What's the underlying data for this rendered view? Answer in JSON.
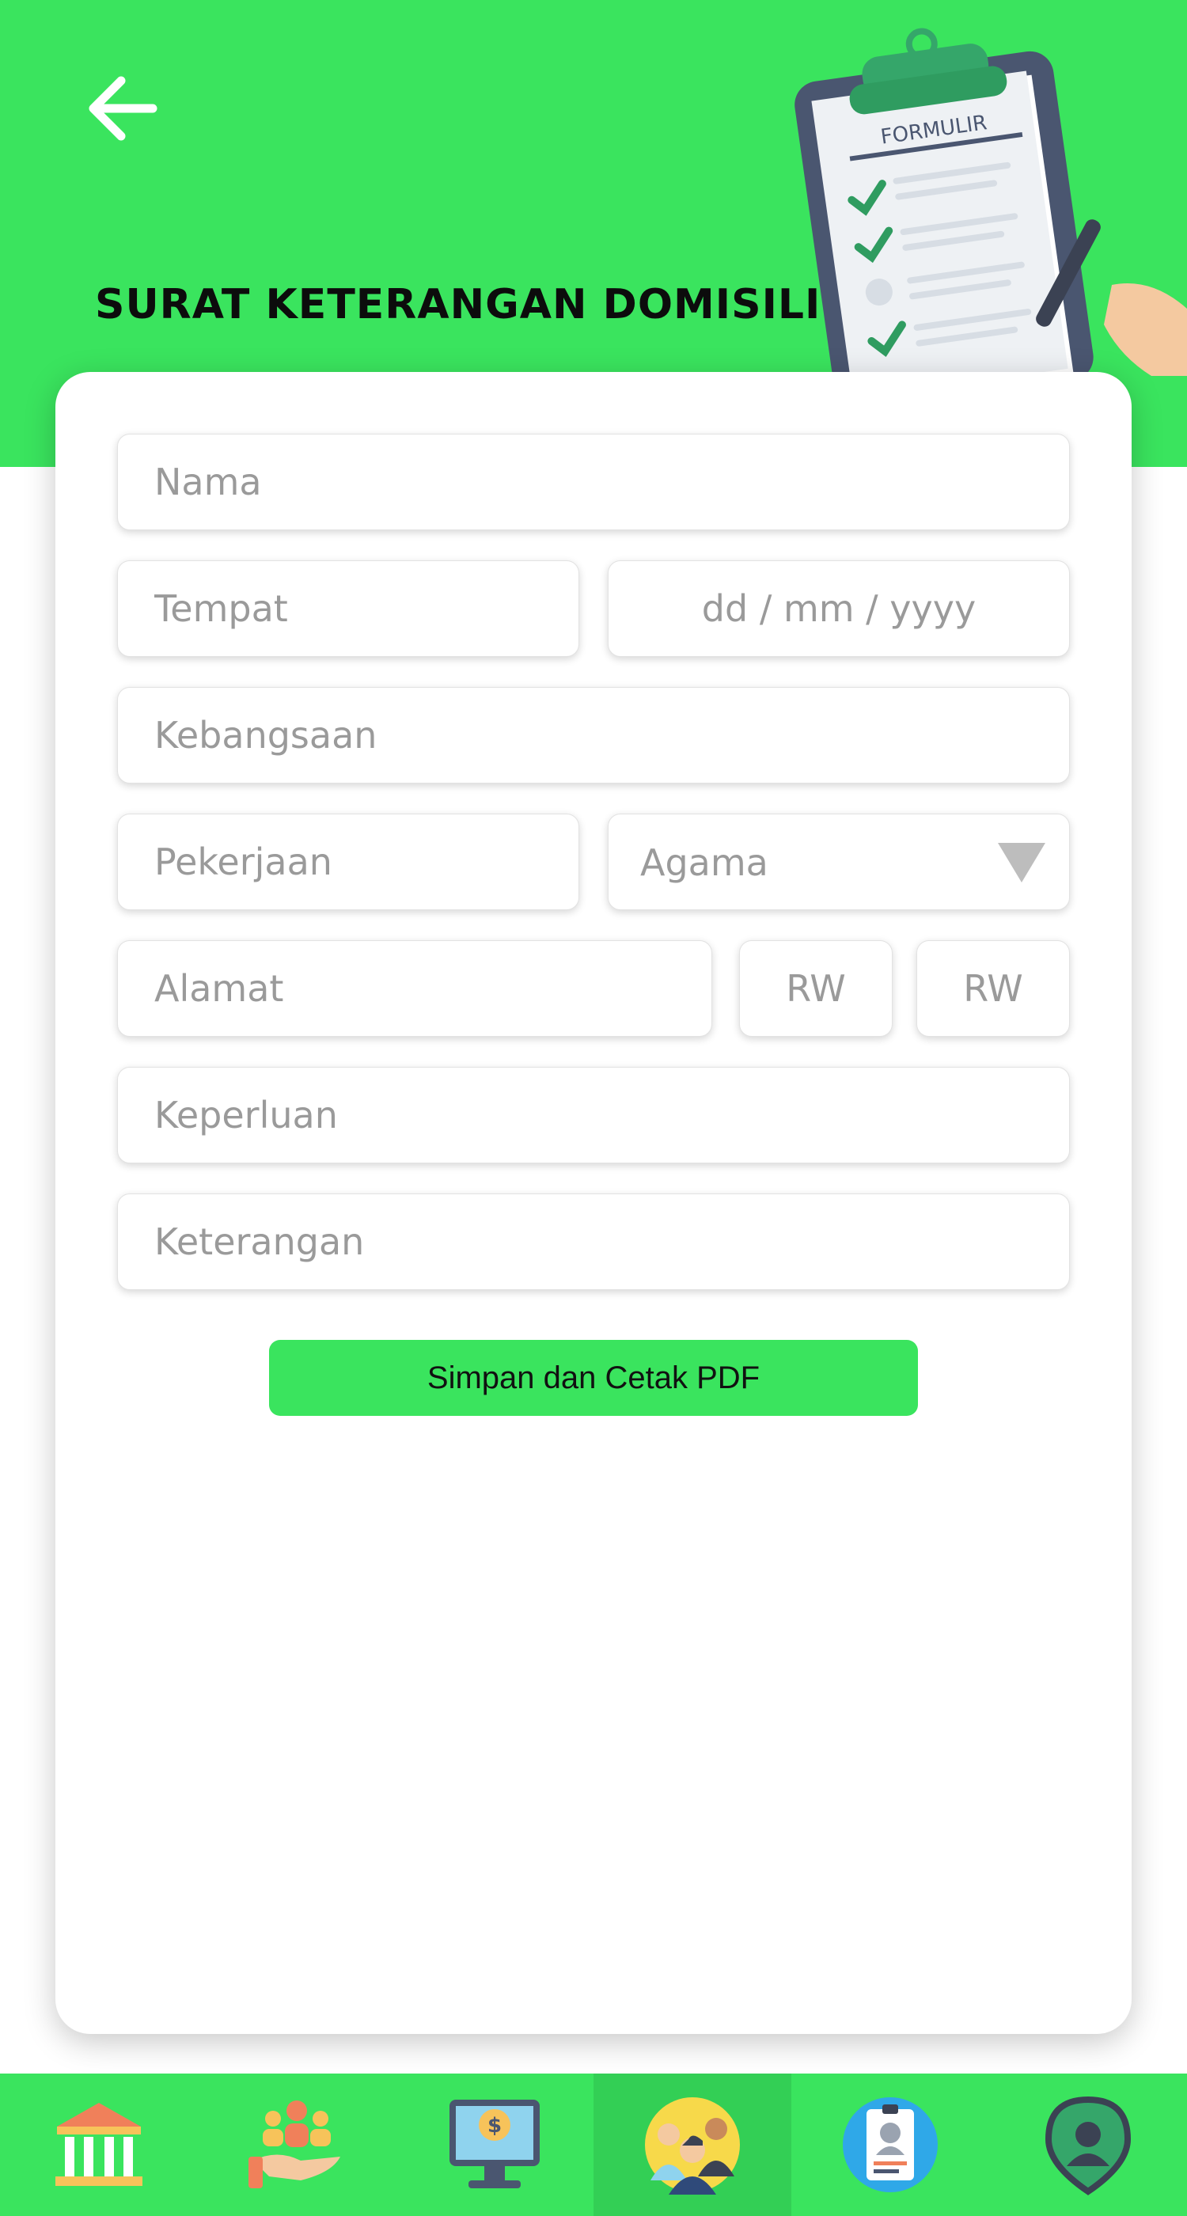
{
  "header": {
    "title": "SURAT KETERANGAN DOMISILI",
    "back_icon": "arrow-left-icon",
    "illustration_label": "FORMULIR",
    "background_color": "#3ae45e"
  },
  "form": {
    "nama_placeholder": "Nama",
    "tempat_placeholder": "Tempat",
    "tanggal_placeholder": "dd / mm / yyyy",
    "kebangsaan_placeholder": "Kebangsaan",
    "pekerjaan_placeholder": "Pekerjaan",
    "agama_value": "Agama",
    "alamat_placeholder": "Alamat",
    "rt_placeholder": "RW",
    "rw_placeholder": "RW",
    "keperluan_placeholder": "Keperluan",
    "keterangan_placeholder": "Keterangan",
    "submit_label": "Simpan dan Cetak PDF"
  },
  "bottom_nav": {
    "active_index": 3,
    "items": [
      {
        "icon": "government-building-icon"
      },
      {
        "icon": "community-hand-icon"
      },
      {
        "icon": "money-monitor-icon"
      },
      {
        "icon": "people-group-icon"
      },
      {
        "icon": "id-card-icon"
      },
      {
        "icon": "location-person-icon"
      }
    ]
  },
  "colors": {
    "accent": "#3ae45e",
    "active_nav": "#33cf55"
  }
}
